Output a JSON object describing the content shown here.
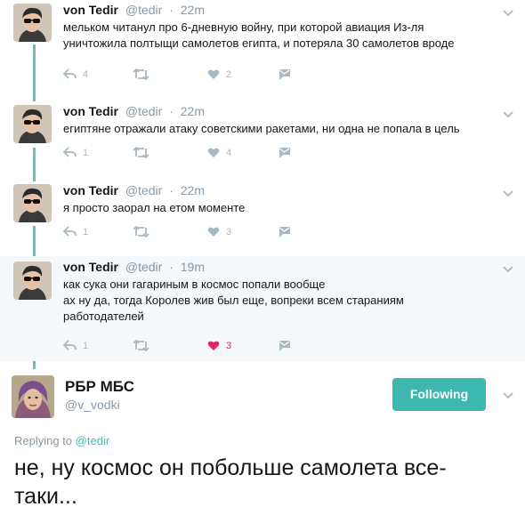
{
  "thread": [
    {
      "name": "von Tedir",
      "handle": "@tedir",
      "time": "22m",
      "lines": [
        "мельком читанул про 6-дневную войну, при которой авиация Из-ля",
        "уничтожила полтыщи самолетов египта, и потеряла 30 самолетов вроде"
      ],
      "replies": "4",
      "likes": "2",
      "liked": false
    },
    {
      "name": "von Tedir",
      "handle": "@tedir",
      "time": "22m",
      "lines": [
        "египтяне отражали атаку советскими ракетами, ни одна не попала в цель"
      ],
      "replies": "1",
      "likes": "4",
      "liked": false
    },
    {
      "name": "von Tedir",
      "handle": "@tedir",
      "time": "22m",
      "lines": [
        "я просто заорал на етом моменте"
      ],
      "replies": "1",
      "likes": "3",
      "liked": false
    },
    {
      "name": "von Tedir",
      "handle": "@tedir",
      "time": "19m",
      "lines": [
        "как сука они гагариным в космос попали вообще",
        "ах ну да, тогда Королев жив был еще, вопреки всем стараниям",
        "работодателей"
      ],
      "replies": "1",
      "likes": "3",
      "liked": true
    }
  ],
  "separator": "·",
  "main": {
    "name": "РБР МБС",
    "handle": "@v_vodki",
    "follow_label": "Following",
    "replying_prefix": "Replying to",
    "replying_handle": "@tedir",
    "text_line1": "не, ну космос он побольше самолета все-",
    "text_line2": "таки..."
  },
  "icons": [
    "reply-icon",
    "retweet-icon",
    "like-icon",
    "message-icon",
    "chevron-down-icon"
  ],
  "colors": {
    "accent": "#3db8b0",
    "thread_line": "#6bbfb8",
    "muted": "#8899a6",
    "icon": "#aab8c2",
    "like_active": "#e0245e"
  }
}
